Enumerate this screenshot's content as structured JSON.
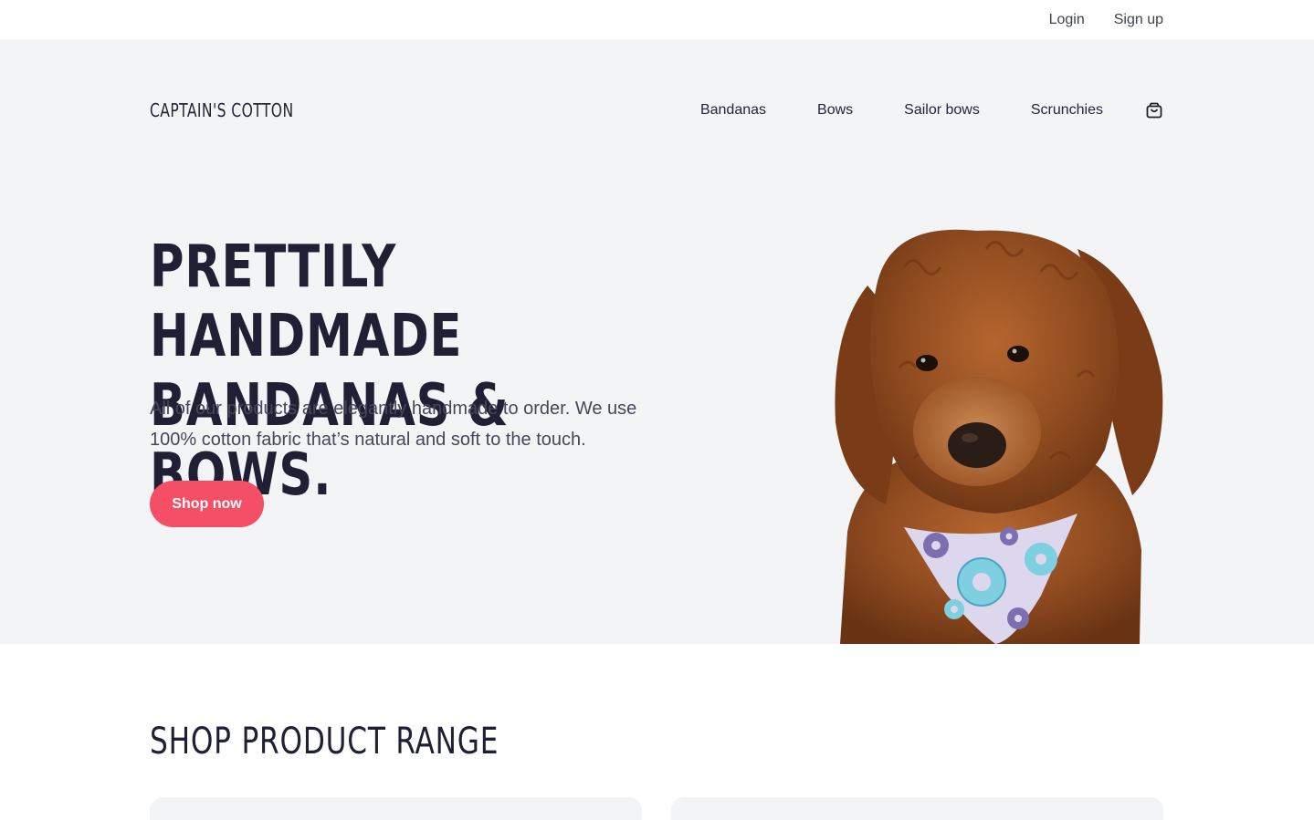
{
  "topbar": {
    "login": "Login",
    "signup": "Sign up"
  },
  "brand": {
    "name": "CAPTAIN'S COTTON"
  },
  "nav": {
    "items": [
      {
        "label": "Bandanas"
      },
      {
        "label": "Bows"
      },
      {
        "label": "Sailor bows"
      },
      {
        "label": "Scrunchies"
      }
    ],
    "cart_icon": "shopping-bag-icon"
  },
  "hero": {
    "headline_line1": "PRETTILY HANDMADE",
    "headline_line2": "BANDANAS & BOWS.",
    "subtitle_line1": "All of our products are elegantly handmade to order. We use",
    "subtitle_line2": "100% cotton fabric that’s natural and soft to the touch.",
    "cta": "Shop now",
    "image": "dog-with-donut-bandana"
  },
  "products": {
    "heading": "SHOP PRODUCT RANGE"
  },
  "colors": {
    "accent": "#f44f66",
    "hero_bg": "#f3f4f6",
    "text": "#1f2033"
  }
}
